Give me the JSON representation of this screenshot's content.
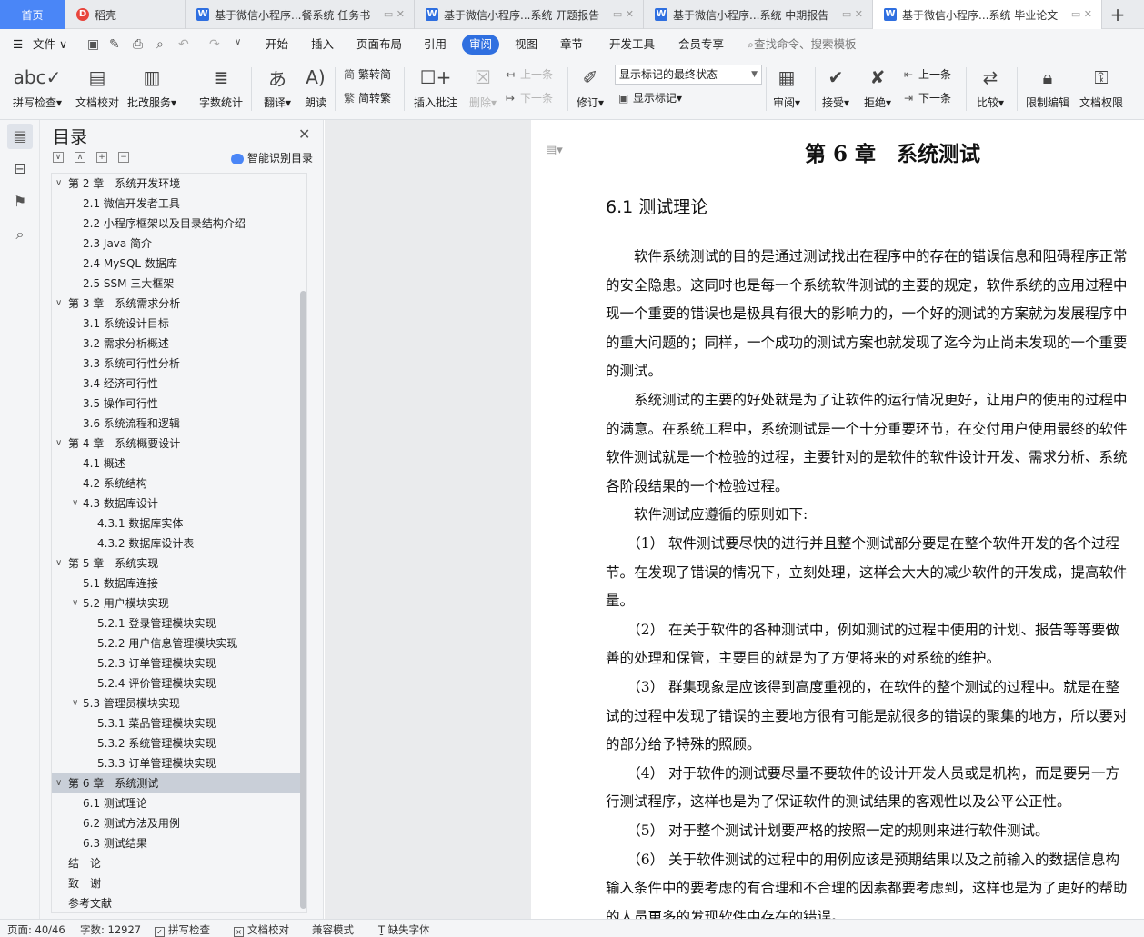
{
  "tabs": [
    {
      "label": "首页"
    },
    {
      "label": "稻壳"
    },
    {
      "label": "基于微信小程序...餐系统 任务书"
    },
    {
      "label": "基于微信小程序...系统 开题报告"
    },
    {
      "label": "基于微信小程序...系统 中期报告"
    },
    {
      "label": "基于微信小程序...系统 毕业论文"
    }
  ],
  "tab_close_icon": "close-icon",
  "menu": {
    "file": "文件",
    "items": [
      "开始",
      "插入",
      "页面布局",
      "引用",
      "审阅",
      "视图",
      "章节",
      "开发工具",
      "会员专享"
    ],
    "active": "审阅",
    "search_placeholder": "查找命令、搜索模板"
  },
  "ribbon": {
    "spell_check": "拼写检查",
    "doc_proofread": "文档校对",
    "review_service": "批改服务",
    "word_count": "字数统计",
    "translate": "翻译",
    "read_aloud": "朗读",
    "trad_simp": "繁转简",
    "simp_trad": "简转繁",
    "insert_comment": "插入批注",
    "delete": "删除",
    "prev_comment": "上一条",
    "next_comment": "下一条",
    "track_changes": "修订",
    "markup_state": "显示标记的最终状态",
    "show_markup": "显示标记",
    "review_pane": "审阅",
    "accept": "接受",
    "reject": "拒绝",
    "prev_change": "上一条",
    "next_change": "下一条",
    "compare": "比较",
    "restrict_edit": "限制编辑",
    "doc_permission": "文档权限"
  },
  "toc": {
    "title": "目录",
    "smart_label": "智能识别目录",
    "items": [
      {
        "label": "第 2 章　系统开发环境",
        "level": 1,
        "toggle": "open"
      },
      {
        "label": "2.1 微信开发者工具",
        "level": 2
      },
      {
        "label": "2.2 小程序框架以及目录结构介绍",
        "level": 2
      },
      {
        "label": "2.3 Java 简介",
        "level": 2
      },
      {
        "label": "2.4 MySQL 数据库",
        "level": 2
      },
      {
        "label": "2.5 SSM 三大框架",
        "level": 2
      },
      {
        "label": "第 3 章　系统需求分析",
        "level": 1,
        "toggle": "open"
      },
      {
        "label": "3.1  系统设计目标",
        "level": 2
      },
      {
        "label": "3.2 需求分析概述",
        "level": 2
      },
      {
        "label": "3.3  系统可行性分析",
        "level": 2
      },
      {
        "label": "3.4 经济可行性",
        "level": 2
      },
      {
        "label": "3.5 操作可行性",
        "level": 2
      },
      {
        "label": "3.6 系统流程和逻辑",
        "level": 2
      },
      {
        "label": "第 4 章　系统概要设计",
        "level": 1,
        "toggle": "open"
      },
      {
        "label": "4.1  概述",
        "level": 2
      },
      {
        "label": "4.2  系统结构",
        "level": 2
      },
      {
        "label": "4.3  数据库设计",
        "level": 2,
        "toggle": "open"
      },
      {
        "label": "4.3.1  数据库实体",
        "level": 3
      },
      {
        "label": "4.3.2  数据库设计表",
        "level": 3
      },
      {
        "label": "第 5 章　系统实现",
        "level": 1,
        "toggle": "open"
      },
      {
        "label": "5.1 数据库连接",
        "level": 2
      },
      {
        "label": "5.2 用户模块实现",
        "level": 2,
        "toggle": "open"
      },
      {
        "label": "5.2.1  登录管理模块实现",
        "level": 3
      },
      {
        "label": "5.2.2  用户信息管理模块实现",
        "level": 3
      },
      {
        "label": "5.2.3  订单管理模块实现",
        "level": 3
      },
      {
        "label": "5.2.4  评价管理模块实现",
        "level": 3
      },
      {
        "label": "5.3  管理员模块实现",
        "level": 2,
        "toggle": "open"
      },
      {
        "label": "5.3.1  菜品管理模块实现",
        "level": 3
      },
      {
        "label": "5.3.2  系统管理模块实现",
        "level": 3
      },
      {
        "label": "5.3.3  订单管理模块实现",
        "level": 3
      },
      {
        "label": "第 6 章　系统测试",
        "level": 1,
        "toggle": "open",
        "selected": true
      },
      {
        "label": "6.1  测试理论",
        "level": 2
      },
      {
        "label": "6.2  测试方法及用例",
        "level": 2
      },
      {
        "label": "6.3 测试结果",
        "level": 2
      },
      {
        "label": "结　论",
        "level": 1
      },
      {
        "label": "致　谢",
        "level": 1
      },
      {
        "label": "参考文献",
        "level": 1
      }
    ]
  },
  "document": {
    "chapter_title": "第 6 章　系统测试",
    "section_title": "6.1  测试理论",
    "lines": [
      "　　软件系统测试的目的是通过测试找出在程序中的存在的错误信息和阻碍程序正常",
      "的安全隐患。这同时也是每一个系统软件测试的主要的规定，软件系统的应用过程中",
      "现一个重要的错误也是极具有很大的影响力的，一个好的测试的方案就为发展程序中",
      "的重大问题的；同样，一个成功的测试方案也就发现了迄今为止尚未发现的一个重要",
      "的测试。",
      "　　系统测试的主要的好处就是为了让软件的运行情况更好，让用户的使用的过程中",
      "的满意。在系统工程中，系统测试是一个十分重要环节，在交付用户使用最终的软件",
      "软件测试就是一个检验的过程，主要针对的是软件的软件设计开发、需求分析、系统",
      "各阶段结果的一个检验过程。",
      "　　软件测试应遵循的原则如下:",
      "　　（1）  软件测试要尽快的进行并且整个测试部分要是在整个软件开发的各个过程",
      "节。在发现了错误的情况下，立刻处理，这样会大大的减少软件的开发成，提高软件",
      "量。",
      "　　（2）  在关于软件的各种测试中，例如测试的过程中使用的计划、报告等等要做",
      "善的处理和保管，主要目的就是为了方便将来的对系统的维护。",
      "　　（3）  群集现象是应该得到高度重视的，在软件的整个测试的过程中。就是在整",
      "试的过程中发现了错误的主要地方很有可能是就很多的错误的聚集的地方，所以要对",
      "的部分给予特殊的照顾。",
      "　　（4）  对于软件的测试要尽量不要软件的设计开发人员或是机构，而是要另一方",
      "行测试程序，这样也是为了保证软件的测试结果的客观性以及公平公正性。",
      "　　（5）  对于整个测试计划要严格的按照一定的规则来进行软件测试。",
      "　　（6）  关于软件测试的过程中的用例应该是预期结果以及之前输入的数据信息构",
      "输入条件中的要考虑的有合理和不合理的因素都要考虑到，这样也是为了更好的帮助",
      "的人员更多的发现软件中存在的错误。"
    ]
  },
  "status": {
    "page": "页面: 40/46",
    "words": "字数: 12927",
    "spell_check": "拼写检查",
    "doc_proofread": "文档校对",
    "compat_mode": "兼容模式",
    "missing_fonts": "缺失字体"
  }
}
